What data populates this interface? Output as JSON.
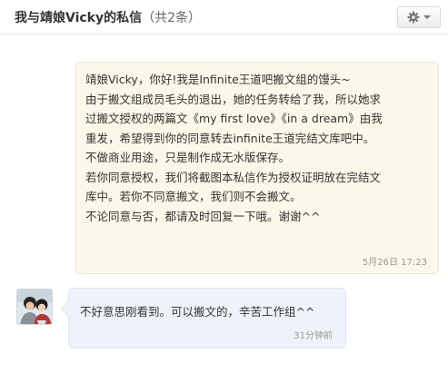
{
  "header": {
    "title_prefix": "我与靖娘Vicky的私信",
    "count_label": "（共2条）"
  },
  "toolbar": {
    "settings_icon": "gear-icon",
    "dropdown_icon": "chevron-down-icon"
  },
  "messages": [
    {
      "direction": "sent",
      "lines": [
        "靖娘Vicky，你好!我是Infinite王道吧搬文组的馒头~",
        "由于搬文组成员毛头的退出，她的任务转给了我，所以她求",
        "过搬文授权的两篇文《my first love》《in a dream》由我",
        "重发，希望得到你的同意转去infinite王道完结文库吧中。",
        "不做商业用途，只是制作成无水版保存。",
        "若你同意授权，我们将截图本私信作为授权证明放在完结文",
        "库中。若你不同意搬文，我们则不会搬文。",
        "不论同意与否，都请及时回复一下哦。谢谢^^"
      ],
      "time": "5月26日 17:23"
    },
    {
      "direction": "received",
      "text": "不好意思刚看到。可以搬文的，辛苦工作组^^",
      "time": "31分钟前"
    }
  ],
  "colors": {
    "sent_bubble": "#fbf8e9",
    "received_bubble": "#eef3f9"
  }
}
